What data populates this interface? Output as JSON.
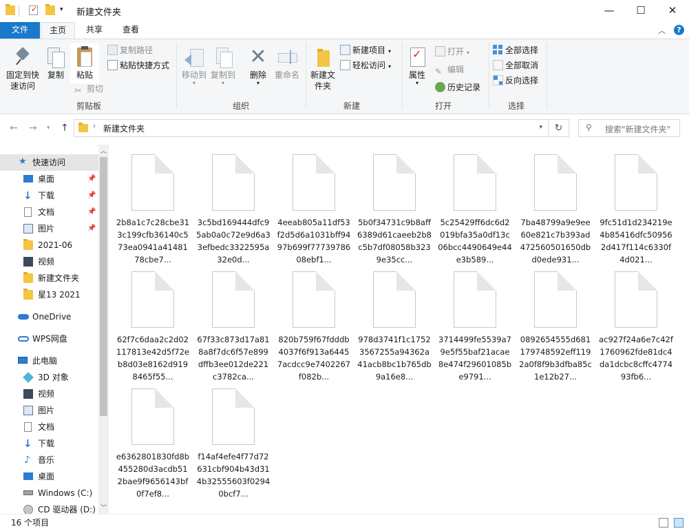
{
  "window": {
    "title": "新建文件夹",
    "minimize": "—",
    "maximize": "☐",
    "close": "✕"
  },
  "tabs": [
    {
      "label": "文件"
    },
    {
      "label": "主页"
    },
    {
      "label": "共享"
    },
    {
      "label": "查看"
    }
  ],
  "ribbon": {
    "clipboard": {
      "group_label": "剪贴板",
      "pin_quick": "固定到快速访问",
      "copy": "复制",
      "paste": "粘贴",
      "copy_path": "复制路径",
      "paste_shortcut": "粘贴快捷方式",
      "cut": "剪切"
    },
    "organize": {
      "group_label": "组织",
      "move_to": "移动到",
      "copy_to": "复制到",
      "delete": "删除",
      "rename": "重命名"
    },
    "new": {
      "group_label": "新建",
      "new_folder": "新建文件夹",
      "new_item": "新建项目",
      "easy_access": "轻松访问"
    },
    "open": {
      "group_label": "打开",
      "properties": "属性",
      "open": "打开",
      "edit": "编辑",
      "history": "历史记录"
    },
    "select": {
      "group_label": "选择",
      "select_all": "全部选择",
      "select_none": "全部取消",
      "invert": "反向选择"
    }
  },
  "address": {
    "path": "新建文件夹",
    "search_placeholder": "搜索\"新建文件夹\""
  },
  "nav": {
    "items": [
      {
        "label": "快速访问",
        "icon": "star-icon"
      },
      {
        "label": "桌面",
        "icon": "desktop-icon"
      },
      {
        "label": "下载",
        "icon": "download-icon"
      },
      {
        "label": "文档",
        "icon": "document-icon"
      },
      {
        "label": "图片",
        "icon": "picture-icon"
      },
      {
        "label": "2021-06",
        "icon": "folder-icon"
      },
      {
        "label": "视频",
        "icon": "video-icon"
      },
      {
        "label": "新建文件夹",
        "icon": "folder-icon"
      },
      {
        "label": "星13 2021",
        "icon": "folder-icon"
      },
      {
        "label": "OneDrive",
        "icon": "cloud-icon"
      },
      {
        "label": "WPS网盘",
        "icon": "cloud-drive-icon"
      },
      {
        "label": "此电脑",
        "icon": "computer-icon"
      },
      {
        "label": "3D 对象",
        "icon": "cube-icon"
      },
      {
        "label": "视频",
        "icon": "video-icon"
      },
      {
        "label": "图片",
        "icon": "picture-icon"
      },
      {
        "label": "文档",
        "icon": "document-icon"
      },
      {
        "label": "下载",
        "icon": "download-icon"
      },
      {
        "label": "音乐",
        "icon": "music-icon"
      },
      {
        "label": "桌面",
        "icon": "desktop-icon"
      },
      {
        "label": "Windows (C:)",
        "icon": "drive-icon"
      },
      {
        "label": "CD 驱动器 (D:)",
        "icon": "cd-drive-icon"
      }
    ]
  },
  "files": [
    {
      "name": "2b8a1c7c28cbe313c199cfb36140c573ea0941a4148178cbe7..."
    },
    {
      "name": "3c5bd169444dfc95ab0a0c72e9d6a33efbedc3322595a32e0d..."
    },
    {
      "name": "4eeab805a11df53f2d5d6a1031bff9497b699f7773978608ebf1..."
    },
    {
      "name": "5b0f34731c9b8aff6389d61caeeb2b8c5b7df08058b3239e35cc..."
    },
    {
      "name": "5c25429ff6dc6d2019bfa35a0df13c06bcc4490649e44e3b589..."
    },
    {
      "name": "7ba48799a9e9ee60e821c7b393ad472560501650dbd0ede931..."
    },
    {
      "name": "9fc51d1d234219e4b85416dfc509562d417f114c6330f4d021..."
    },
    {
      "name": "62f7c6daa2c2d02117813e42d5f72eb8d03e8162d9198465f55..."
    },
    {
      "name": "67f33c873d17a818a8f7dc6f57e899dffb3ee012de221c3782ca..."
    },
    {
      "name": "820b759f67fdddb4037f6f913a64457acdcc9e7402267f082b..."
    },
    {
      "name": "978d3741f1c17523567255a94362a41acb8bc1b765db9a16e8..."
    },
    {
      "name": "3714499fe5539a79e5f55baf21acae8e474f29601085be9791..."
    },
    {
      "name": "0892654555d681179748592eff1192a0f8f9b3dfba85c1e12b27..."
    },
    {
      "name": "ac927f24a6e7c42f1760962fde81dc4da1dcbc8cffc477493fb6..."
    },
    {
      "name": "e6362801830fd8b455280d3acdb512bae9f9656143bf0f7ef8..."
    },
    {
      "name": "f14af4efe4f77d72631cbf904b43d314b32555603f02940bcf7..."
    }
  ],
  "status": {
    "count": "16 个项目"
  }
}
